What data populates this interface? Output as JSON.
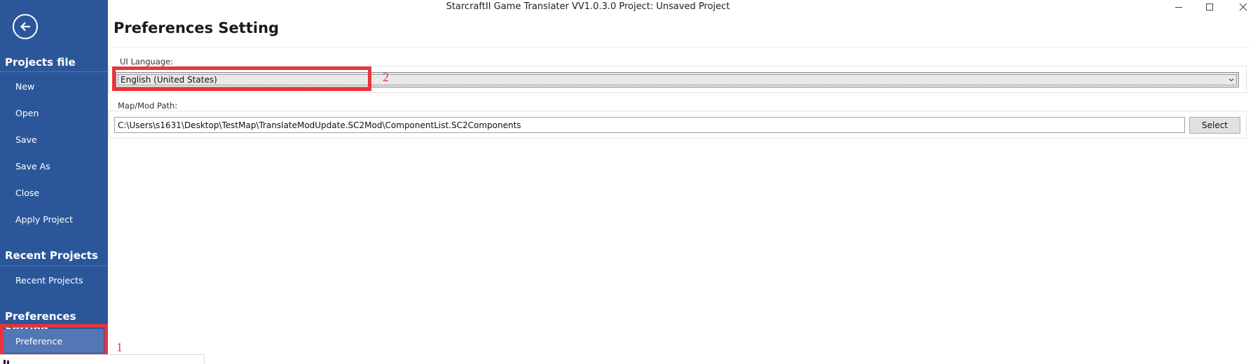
{
  "window": {
    "title": "StarcraftII Game Translater VV1.0.3.0 Project: Unsaved Project",
    "controls": [
      "minimize-icon",
      "maximize-icon",
      "close-icon"
    ]
  },
  "sidebar": {
    "back_icon": "arrow-left-icon",
    "sections": [
      {
        "title": "Projects file",
        "items": [
          {
            "label": "New"
          },
          {
            "label": "Open"
          },
          {
            "label": "Save"
          },
          {
            "label": "Save As"
          },
          {
            "label": "Close"
          },
          {
            "label": "Apply Project"
          }
        ]
      },
      {
        "title": "Recent Projects",
        "items": [
          {
            "label": "Recent Projects"
          }
        ]
      },
      {
        "title": "Preferences Setting",
        "items": [
          {
            "label": "Preference",
            "selected": true
          }
        ]
      }
    ]
  },
  "main": {
    "title": "Preferences Setting",
    "ui_language": {
      "label": "UI Language:",
      "selected": "English (United States)"
    },
    "map_path": {
      "label": "Map/Mod Path:",
      "value": "C:\\Users\\s1631\\Desktop\\TestMap\\TranslateModUpdate.SC2Mod\\ComponentList.SC2Components",
      "button_label": "Select"
    }
  },
  "annotations": [
    {
      "number": "1"
    },
    {
      "number": "2"
    }
  ],
  "colors": {
    "sidebar_bg": "#2b579a",
    "sidebar_selected": "#5277b4",
    "annotation_red": "#e8343d"
  }
}
